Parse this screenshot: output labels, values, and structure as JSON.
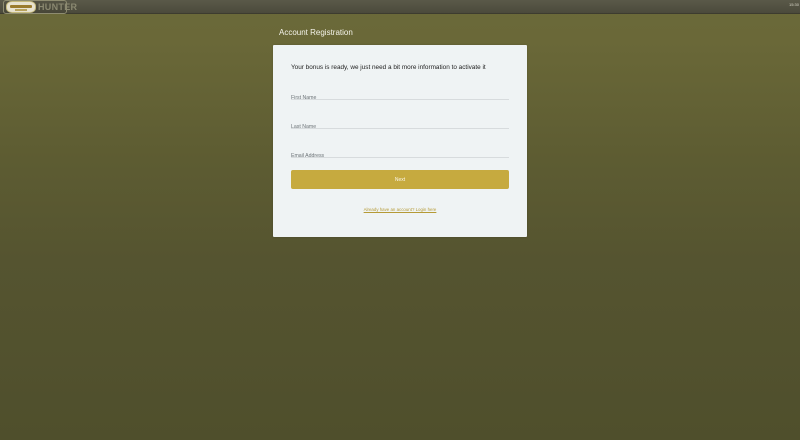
{
  "header": {
    "logo_text": "HUNTER",
    "right_text": "15:30"
  },
  "page": {
    "heading": "Account Registration"
  },
  "form": {
    "title": "Your bonus is ready, we just need a bit more information to activate it",
    "first_name": {
      "placeholder": "First Name",
      "value": ""
    },
    "last_name": {
      "placeholder": "Last Name",
      "value": ""
    },
    "email": {
      "placeholder": "Email Address",
      "value": ""
    },
    "next_label": "Next",
    "login_link": "Already have an account? Login here"
  },
  "colors": {
    "accent": "#c6aa3f",
    "link": "#b59a36",
    "card": "#eff3f4"
  }
}
